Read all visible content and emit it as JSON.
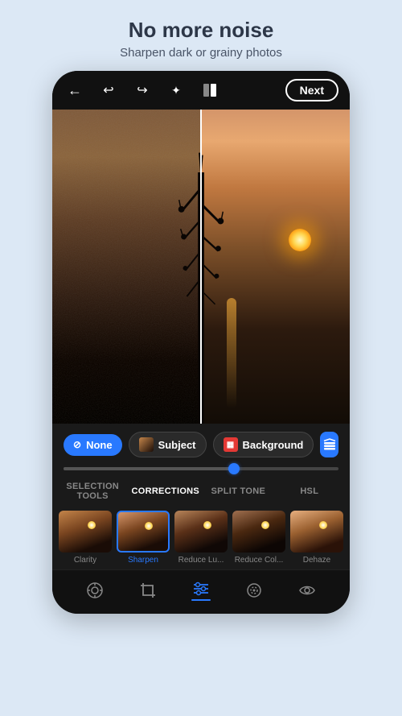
{
  "header": {
    "title": "No more noise",
    "subtitle": "Sharpen dark or grainy photos"
  },
  "topbar": {
    "next_label": "Next"
  },
  "selection": {
    "pills": [
      {
        "id": "none",
        "label": "None",
        "active": true
      },
      {
        "id": "subject",
        "label": "Subject"
      },
      {
        "id": "background",
        "label": "Background"
      }
    ]
  },
  "tabs": [
    {
      "id": "selection-tools",
      "label": "SELECTION TOOLS",
      "active": false
    },
    {
      "id": "corrections",
      "label": "CORRECTIONS",
      "active": true
    },
    {
      "id": "split-tone",
      "label": "SPLIT TONE",
      "active": false
    },
    {
      "id": "hsl",
      "label": "HSL",
      "active": false
    }
  ],
  "thumbnails": [
    {
      "label": "Clarity",
      "active": false
    },
    {
      "label": "Sharpen",
      "active": true
    },
    {
      "label": "Reduce Lu...",
      "active": false
    },
    {
      "label": "Reduce Col...",
      "active": false
    },
    {
      "label": "Dehaze",
      "active": false
    }
  ],
  "bottomnav": [
    {
      "id": "camera",
      "label": "camera",
      "active": false
    },
    {
      "id": "crop",
      "label": "crop",
      "active": false
    },
    {
      "id": "adjustments",
      "label": "adjustments",
      "active": true
    },
    {
      "id": "healing",
      "label": "healing",
      "active": false
    },
    {
      "id": "eye",
      "label": "eye",
      "active": false
    }
  ],
  "icons": {
    "back": "←",
    "undo": "↩",
    "redo": "↪",
    "magic": "✦",
    "compare": "⬛",
    "none_icon": "⊘",
    "layers": "⊞"
  }
}
